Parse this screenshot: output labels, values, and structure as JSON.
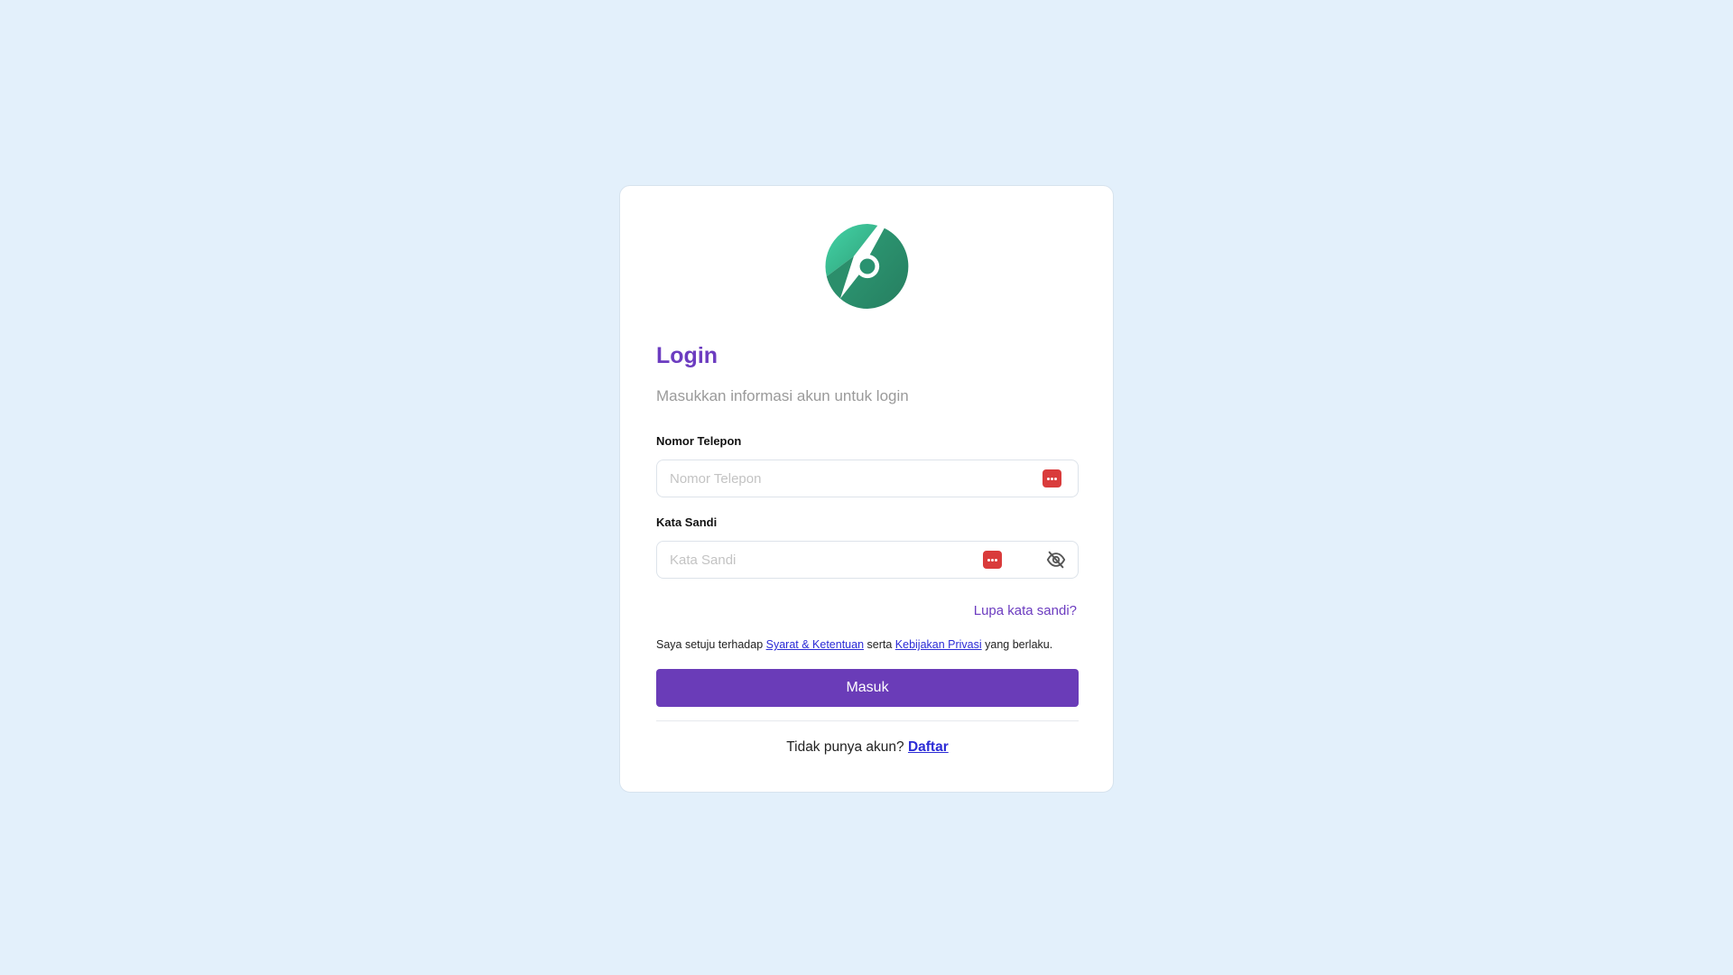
{
  "login": {
    "title": "Login",
    "subtitle": "Masukkan informasi akun untuk login",
    "phone": {
      "label": "Nomor Telepon",
      "placeholder": "Nomor Telepon",
      "value": ""
    },
    "password": {
      "label": "Kata Sandi",
      "placeholder": "Kata Sandi",
      "value": ""
    },
    "forgot_password": "Lupa kata sandi?",
    "terms": {
      "prefix": "Saya setuju terhadap ",
      "terms_link": "Syarat & Ketentuan",
      "middle": " serta ",
      "privacy_link": "Kebijakan Privasi",
      "suffix": " yang berlaku."
    },
    "submit_label": "Masuk",
    "register": {
      "prompt": "Tidak punya akun? ",
      "link": "Daftar"
    }
  },
  "icons": {
    "logo": "brand-logo",
    "field_keyboard": "keyboard-icon",
    "password_toggle": "eye-off-icon"
  },
  "colors": {
    "background": "#e3f0fb",
    "accent": "#6a3cb8",
    "title": "#6c3cc0",
    "logo_light": "#3cc59a",
    "logo_dark": "#2a8f6c",
    "keyboard_icon": "#d93b3b",
    "link": "#2b2bd6"
  }
}
